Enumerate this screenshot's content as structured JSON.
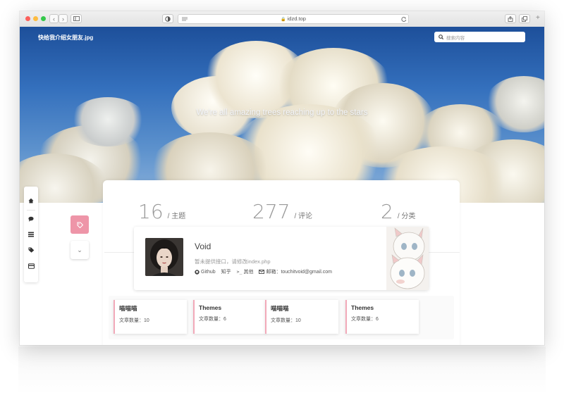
{
  "browser": {
    "url": "idzd.top"
  },
  "site": {
    "title": "快给我介绍女朋友.jpg",
    "search_placeholder": "搜索内容",
    "tagline": "We're all amazing trees reaching up to the stars"
  },
  "stats": [
    {
      "value": "16",
      "label": "/ 主题"
    },
    {
      "value": "277",
      "label": "/ 评论"
    },
    {
      "value": "2",
      "label": "/ 分类"
    }
  ],
  "profile": {
    "name": "Void",
    "description": "暂未提供接口，请修改index.php",
    "links": {
      "github": "Github",
      "zhihu": "知乎",
      "other": "其他",
      "email": "邮箱：touchitvoid@gmail.com"
    }
  },
  "categories": [
    {
      "title": "喵喵喵",
      "count": "文章数量：10"
    },
    {
      "title": "Themes",
      "count": "文章数量：6"
    },
    {
      "title": "喵喵喵",
      "count": "文章数量：10"
    },
    {
      "title": "Themes",
      "count": "文章数量：6"
    }
  ],
  "icons": {
    "sidenav": [
      "home-icon",
      "comment-icon",
      "list-icon",
      "tags-icon",
      "card-icon"
    ],
    "pink_button": "tag-icon",
    "expand": "chevron-down-icon"
  },
  "colors": {
    "accent_pink": "#ee95a8",
    "category_border": "#f2a9b9",
    "sky": "#3470bd"
  }
}
